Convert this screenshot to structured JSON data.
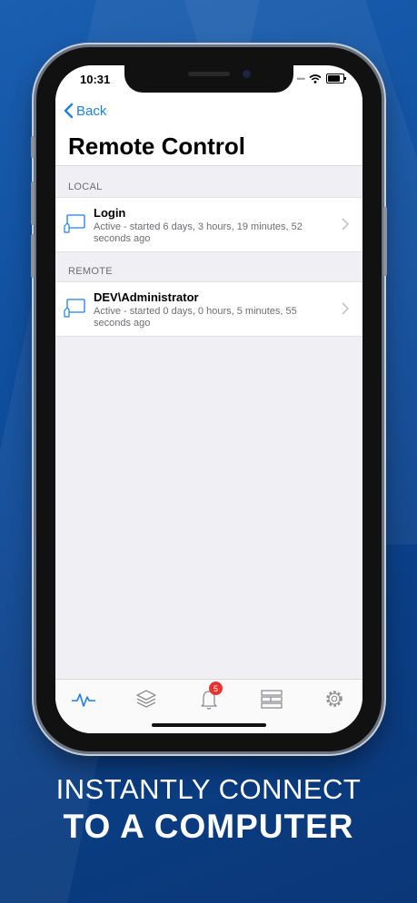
{
  "status_bar": {
    "time": "10:31"
  },
  "nav": {
    "back_label": "Back",
    "title": "Remote Control"
  },
  "sections": [
    {
      "header": "LOCAL",
      "items": [
        {
          "title": "Login",
          "subtitle": "Active - started 6 days, 3 hours, 19 minutes, 52 seconds ago"
        }
      ]
    },
    {
      "header": "REMOTE",
      "items": [
        {
          "title": "DEV\\Administrator",
          "subtitle": "Active - started 0 days, 0 hours, 5 minutes, 55 seconds ago"
        }
      ]
    }
  ],
  "tabbar": {
    "tabs": [
      "activity-icon",
      "layers-icon",
      "bell-icon",
      "server-icon",
      "gear-icon"
    ],
    "notification_badge": "5"
  },
  "tagline": {
    "line1": "INSTANTLY CONNECT",
    "line2": "TO A COMPUTER"
  },
  "colors": {
    "accent": "#1d7ee8",
    "badge": "#e8322d",
    "background": "#0d4a99"
  }
}
